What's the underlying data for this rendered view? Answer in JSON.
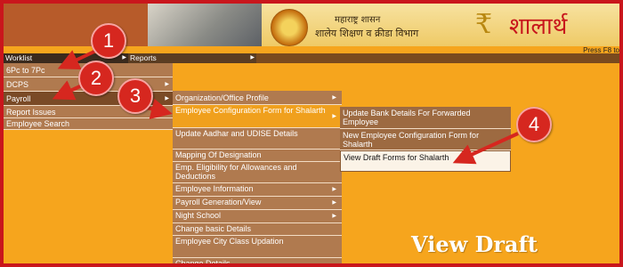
{
  "header": {
    "gov_line_1": "महाराष्ट्र शासन",
    "gov_line_2": "शालेय शिक्षण व क्रीडा विभाग",
    "logo_mark": "₹",
    "logo_text": "शालार्थ",
    "help_hint": "Press F8 to"
  },
  "menubar": [
    {
      "label": "Worklist"
    },
    {
      "label": "Reports"
    }
  ],
  "worklist": [
    {
      "label": "6Pc to 7Pc"
    },
    {
      "label": "DCPS"
    },
    {
      "label": "Payroll"
    },
    {
      "label": "Report Issues"
    },
    {
      "label": "Employee Search"
    }
  ],
  "payroll": [
    {
      "label": "Organization/Office Profile"
    },
    {
      "label": "Employee Configuration Form for Shalarth"
    },
    {
      "label": "Update Aadhar and UDISE Details"
    },
    {
      "label": "Mapping Of Designation"
    },
    {
      "label": "Emp. Eligibility for Allowances and Deductions"
    },
    {
      "label": "Employee Information"
    },
    {
      "label": "Payroll Generation/View"
    },
    {
      "label": "Night School"
    },
    {
      "label": "Change basic Details"
    },
    {
      "label": "Employee City Class Updation"
    },
    {
      "label": "Change Details"
    }
  ],
  "employee_configuration": [
    {
      "label": "Update Bank Details For Forwarded Employee"
    },
    {
      "label": "New Employee Configuration Form for Shalarth"
    },
    {
      "label": "View Draft Forms for Shalarth"
    }
  ],
  "annotations": [
    "1",
    "2",
    "3",
    "4"
  ],
  "caption": "View Draft",
  "colors": {
    "background": "#f6a51d",
    "frame_border": "#c9161c",
    "menu_item": "#b07a4f",
    "menu_bar": "#3b2a1d",
    "badge": "#d6271f"
  }
}
